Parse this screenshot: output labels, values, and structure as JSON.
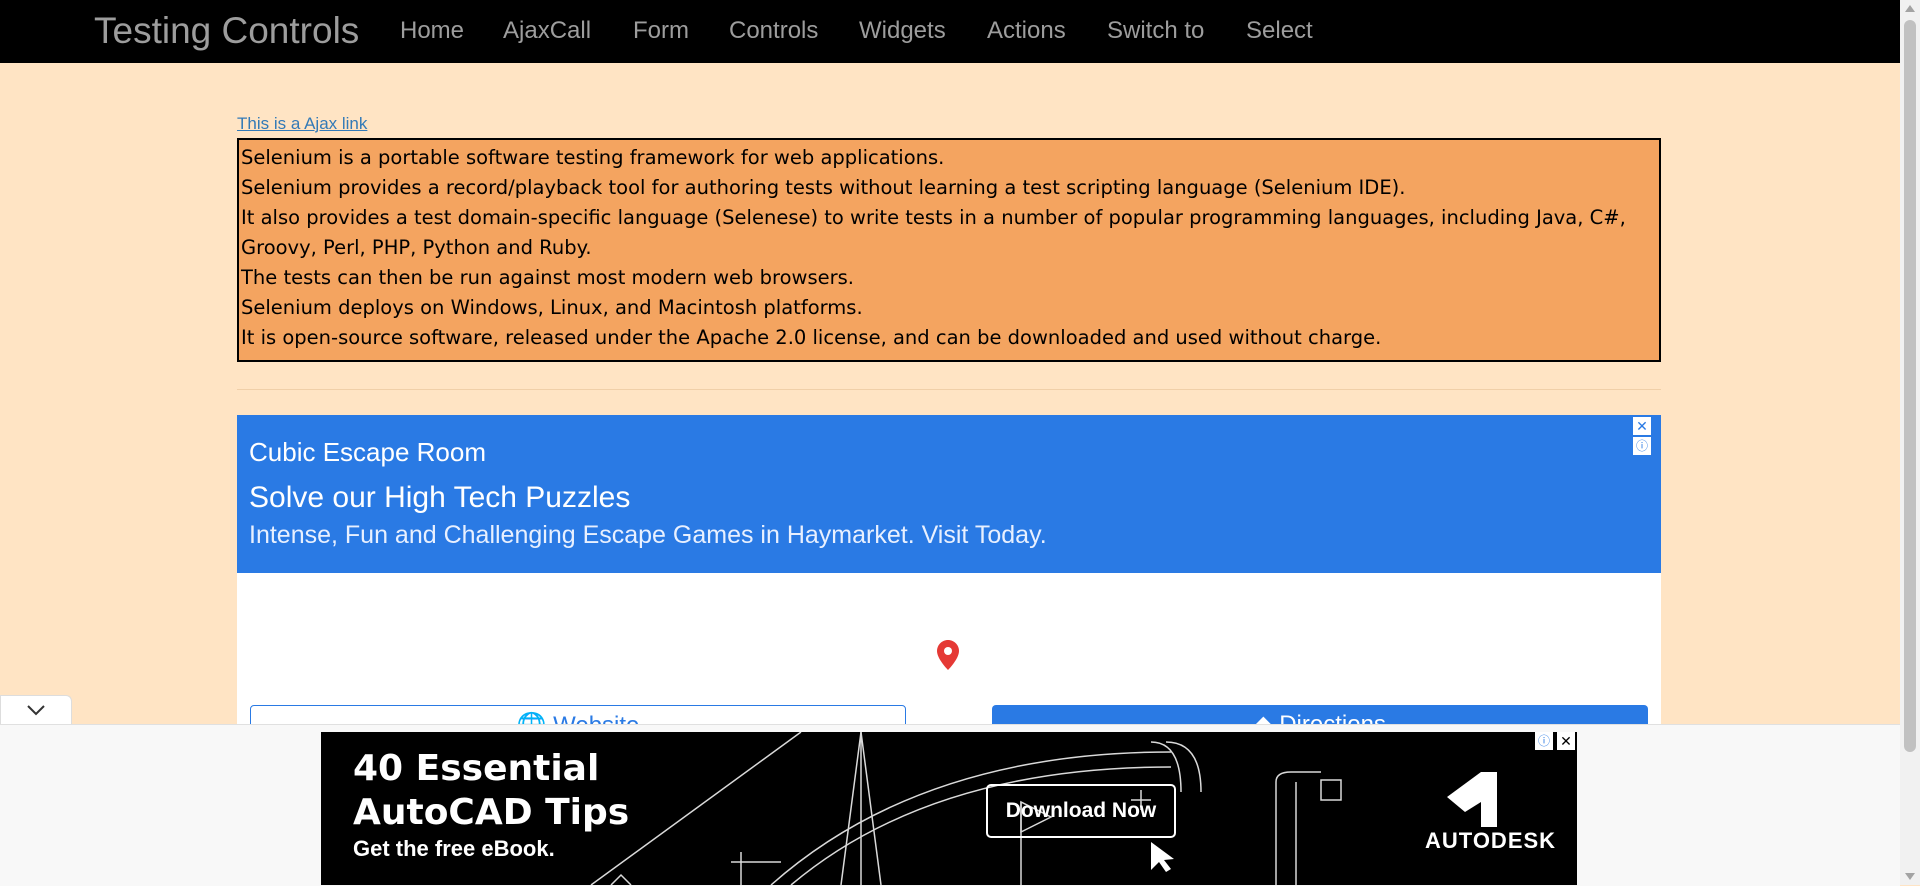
{
  "navbar": {
    "brand": "Testing Controls",
    "items": [
      "Home",
      "AjaxCall",
      "Form",
      "Controls",
      "Widgets",
      "Actions",
      "Switch to",
      "Select"
    ]
  },
  "ajax_link": "This is a Ajax link",
  "selenium_lines": [
    "Selenium is a portable software testing framework for web applications.",
    "Selenium provides a record/playback tool for authoring tests without learning a test scripting language (Selenium IDE).",
    "It also provides a test domain-specific language (Selenese) to write tests in a number of popular programming languages, including Java, C#, Groovy, Perl, PHP, Python and Ruby.",
    "The tests can then be run against most modern web browsers.",
    "Selenium deploys on Windows, Linux, and Macintosh platforms.",
    "It is open-source software, released under the Apache 2.0 license, and can be downloaded and used without charge."
  ],
  "ad": {
    "brand": "Cubic Escape Room",
    "headline": "Solve our High Tech Puzzles",
    "description": "Intense, Fun and Challenging Escape Games in Haymarket. Visit Today.",
    "website_label": "Website",
    "directions_label": "Directions"
  },
  "banner": {
    "line1": "40 Essential",
    "line2": "AutoCAD Tips",
    "sub": "Get the free eBook.",
    "button": "Download Now",
    "brand": "AUTODESK"
  },
  "colors": {
    "page_bg": "#ffe4c4",
    "box_bg": "#f4a460",
    "ad_blue": "#2a7ae4",
    "nav_bg": "#000000"
  }
}
